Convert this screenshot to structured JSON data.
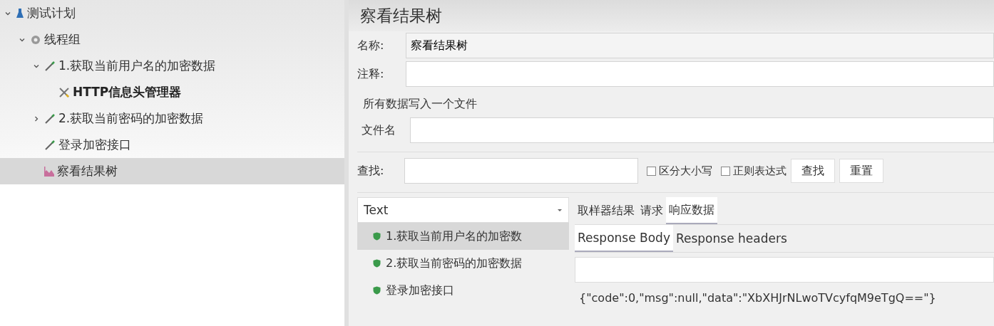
{
  "tree": [
    {
      "label": "测试计划",
      "kind": "plan",
      "expanded": true,
      "selected": false,
      "children": [
        {
          "label": "线程组",
          "kind": "threads",
          "expanded": true,
          "selected": false,
          "children": [
            {
              "label": "1.获取当前用户名的加密数据",
              "kind": "sampler",
              "expanded": true,
              "selected": false,
              "children": [
                {
                  "label": "HTTP信息头管理器",
                  "kind": "config",
                  "selected": false
                }
              ]
            },
            {
              "label": "2.获取当前密码的加密数据",
              "kind": "sampler",
              "expanded": false,
              "selected": false
            },
            {
              "label": "登录加密接口",
              "kind": "sampler",
              "selected": false
            },
            {
              "label": "察看结果树",
              "kind": "listener",
              "selected": true
            }
          ]
        }
      ]
    }
  ],
  "panel": {
    "title": "察看结果树",
    "name_label": "名称:",
    "name_value": "察看结果树",
    "comment_label": "注释:",
    "file_section": "所有数据写入一个文件",
    "file_label": "文件名"
  },
  "search": {
    "label": "查找:",
    "options": [
      {
        "label": "区分大小写",
        "checked": false
      },
      {
        "label": "正则表达式",
        "checked": false
      }
    ],
    "buttons": [
      "查找",
      "重置"
    ]
  },
  "results": {
    "renderer": "Text",
    "items": [
      {
        "label": "1.获取当前用户名的加密数",
        "selected": true
      },
      {
        "label": "2.获取当前密码的加密数据",
        "selected": false
      },
      {
        "label": "登录加密接口",
        "selected": false
      }
    ],
    "tabs": [
      {
        "label": "取样器结果",
        "selected": false
      },
      {
        "label": "请求",
        "selected": false
      },
      {
        "label": "响应数据",
        "selected": true
      }
    ],
    "subtabs": [
      {
        "label": "Response Body",
        "selected": true
      },
      {
        "label": "Response headers",
        "selected": false
      }
    ],
    "body": "{\"code\":0,\"msg\":null,\"data\":\"XbXHJrNLwoTVcyfqM9eTgQ==\"}"
  }
}
